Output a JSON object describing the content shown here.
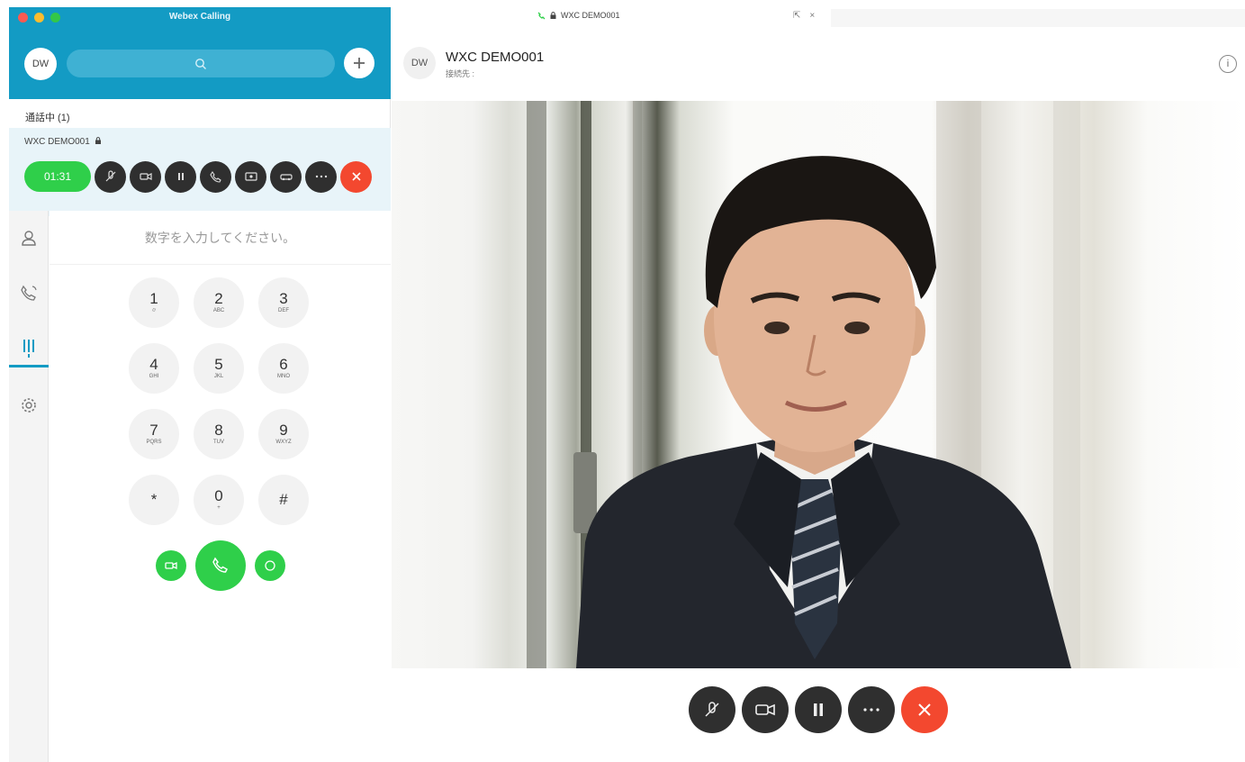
{
  "app": {
    "window_title": "Webex Calling",
    "user_initials": "DW"
  },
  "active_calls": {
    "section_label": "通話中 (1)",
    "call_name": "WXC DEMO001",
    "timer": "01:31"
  },
  "dialpad": {
    "placeholder": "数字を入力してください。",
    "keys": [
      {
        "digit": "1",
        "letters": "⌭"
      },
      {
        "digit": "2",
        "letters": "ABC"
      },
      {
        "digit": "3",
        "letters": "DEF"
      },
      {
        "digit": "4",
        "letters": "GHI"
      },
      {
        "digit": "5",
        "letters": "JKL"
      },
      {
        "digit": "6",
        "letters": "MNO"
      },
      {
        "digit": "7",
        "letters": "PQRS"
      },
      {
        "digit": "8",
        "letters": "TUV"
      },
      {
        "digit": "9",
        "letters": "WXYZ"
      },
      {
        "digit": "*",
        "letters": ""
      },
      {
        "digit": "0",
        "letters": "+"
      },
      {
        "digit": "#",
        "letters": ""
      }
    ]
  },
  "call_window": {
    "tab_title": "WXC DEMO001",
    "callee_initials": "DW",
    "callee_name": "WXC DEMO001",
    "callee_status": "接続先 :"
  },
  "colors": {
    "header": "#139bc4",
    "green": "#2fcf4a",
    "red": "#f3482f",
    "dark_button": "#2f2f2f"
  }
}
